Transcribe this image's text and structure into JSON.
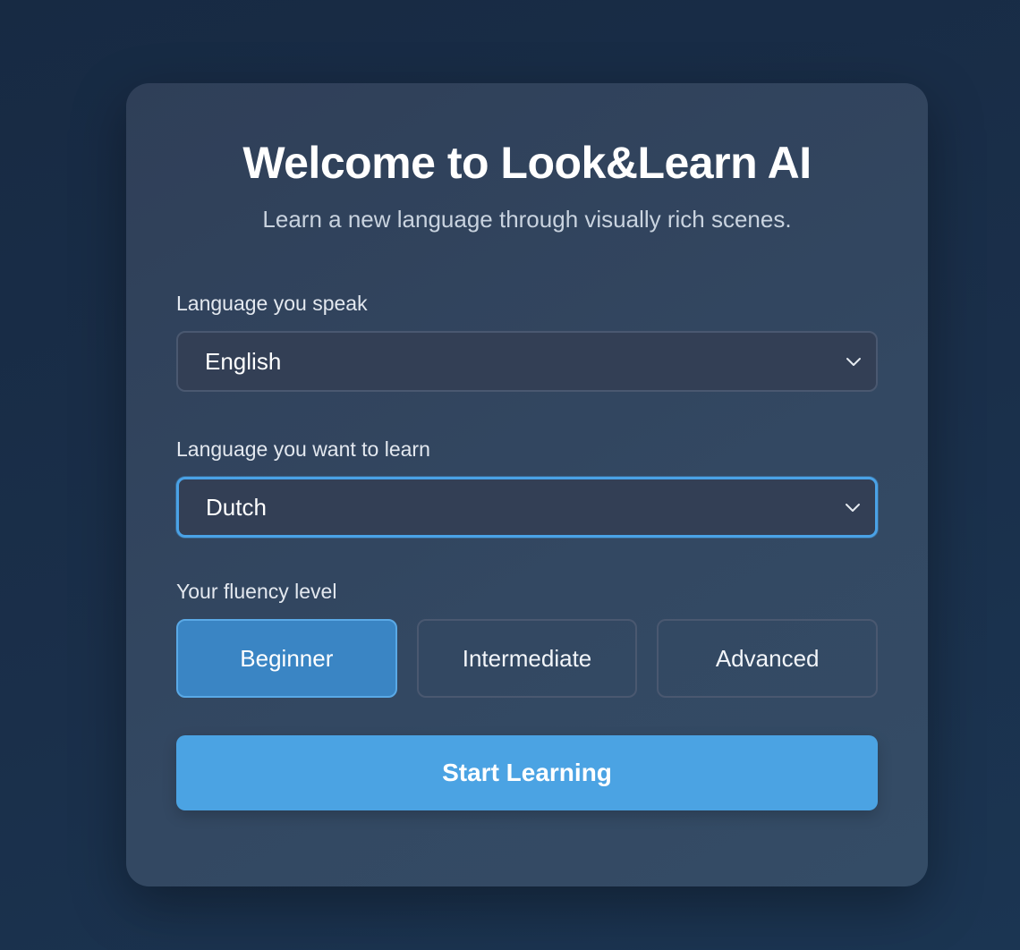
{
  "welcome": {
    "title": "Welcome to Look&Learn AI",
    "subtitle": "Learn a new language through visually rich scenes."
  },
  "form": {
    "speak_label": "Language you speak",
    "speak_value": "English",
    "learn_label": "Language you want to learn",
    "learn_value": "Dutch",
    "level_label": "Your fluency level",
    "levels": [
      {
        "label": "Beginner",
        "selected": true
      },
      {
        "label": "Intermediate",
        "selected": false
      },
      {
        "label": "Advanced",
        "selected": false
      }
    ],
    "start_label": "Start Learning"
  },
  "icons": {
    "dropdown": "chevron-down-icon"
  },
  "colors": {
    "accent": "#4ba3e3",
    "selected_level": "#3a85c4",
    "focus_ring": "#4aa2e6"
  }
}
